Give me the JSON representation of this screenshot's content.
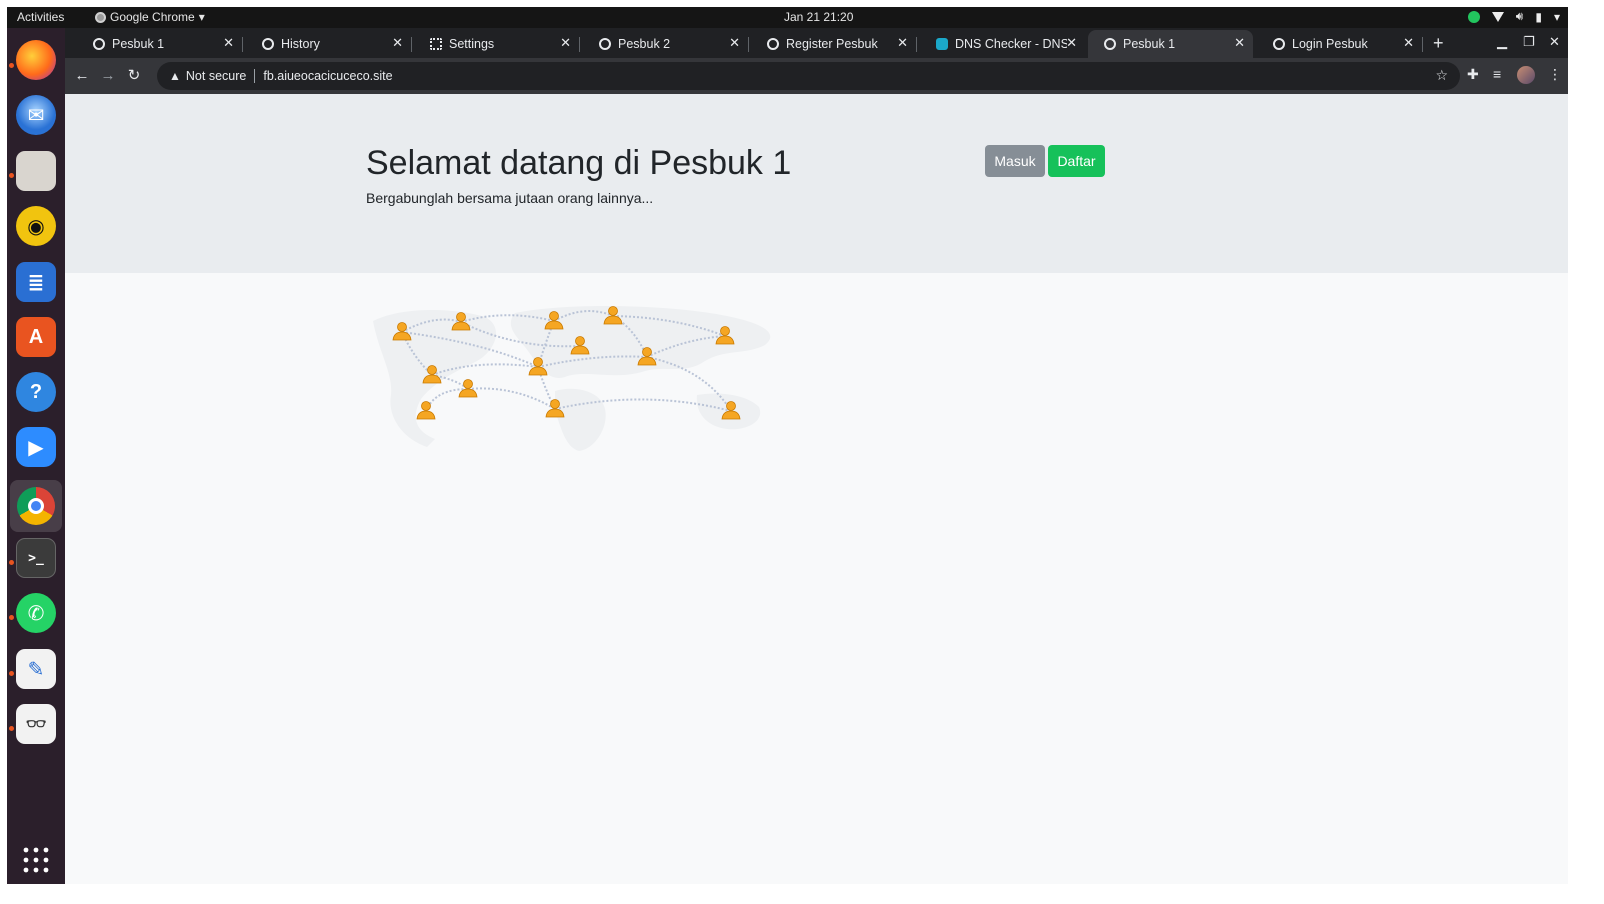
{
  "system": {
    "activities": "Activities",
    "app_name": "Google Chrome",
    "clock": "Jan 21  21:20"
  },
  "dock": {
    "items": [
      "firefox-icon",
      "thunderbird-icon",
      "files-icon",
      "rhythmbox-icon",
      "writer-icon",
      "software-icon",
      "help-icon",
      "zoom-icon",
      "chrome-icon",
      "terminal-icon",
      "whatsapp-icon",
      "text-editor-icon",
      "document-viewer-icon",
      "app-grid-icon"
    ]
  },
  "browser": {
    "tabs": [
      {
        "title": "Pesbuk 1",
        "icon": "globe-icon"
      },
      {
        "title": "History",
        "icon": "history-icon"
      },
      {
        "title": "Settings",
        "icon": "gear-icon"
      },
      {
        "title": "Pesbuk 2",
        "icon": "globe-icon"
      },
      {
        "title": "Register Pesbuk",
        "icon": "globe-icon"
      },
      {
        "title": "DNS Checker - DNS C",
        "icon": "dns-checker-icon"
      },
      {
        "title": "Pesbuk 1",
        "icon": "globe-icon"
      },
      {
        "title": "Login Pesbuk",
        "icon": "globe-icon"
      }
    ],
    "active_tab": 6,
    "new_tab": "+",
    "security_label": "Not secure",
    "url": "fb.aiueocacicuceco.site"
  },
  "page": {
    "heading": "Selamat datang di Pesbuk 1",
    "lead": "Bergabunglah bersama jutaan orang lainnya...",
    "login_button": "Masuk",
    "register_button": "Daftar",
    "colors": {
      "jumbotron": "#e9ecef",
      "masuk": "#868e96",
      "daftar": "#16c15a",
      "person": "#f5a623"
    }
  }
}
